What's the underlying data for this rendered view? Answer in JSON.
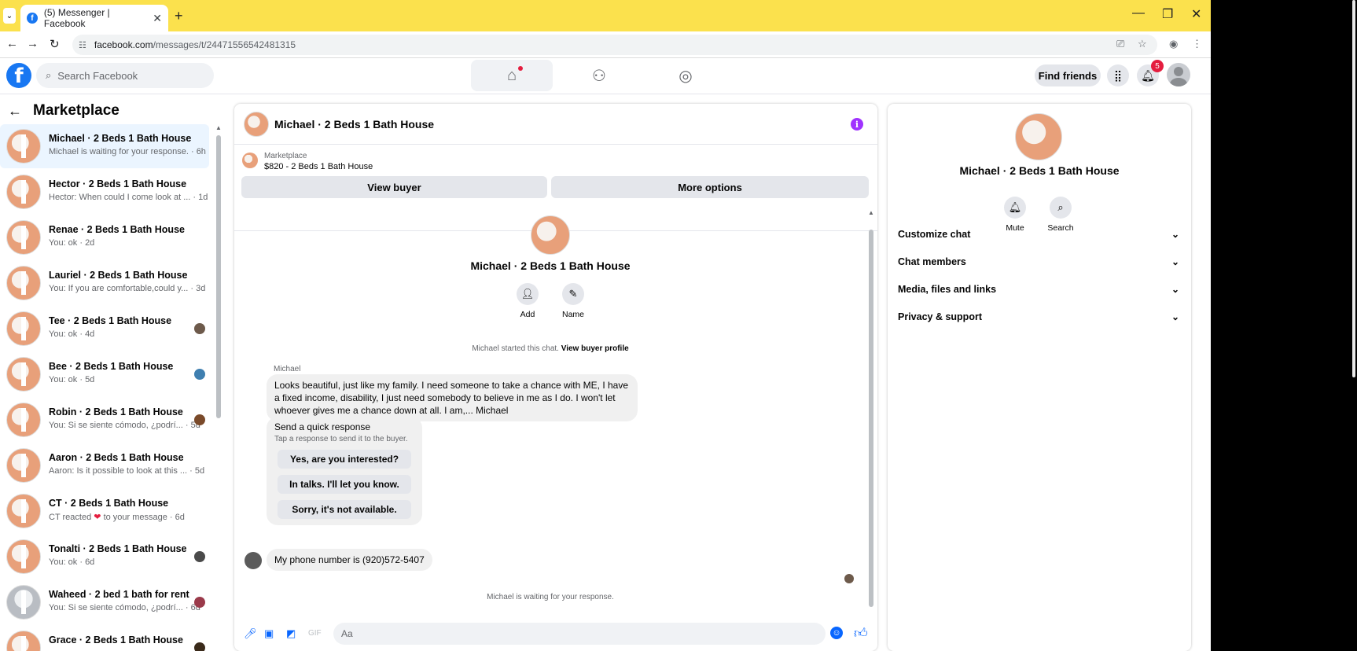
{
  "browser": {
    "tab_title": "(5) Messenger | Facebook",
    "url_host": "facebook.com",
    "url_path": "/messages/t/24471556542481315"
  },
  "header": {
    "search_placeholder": "Search Facebook",
    "find_friends": "Find friends",
    "notification_count": "5"
  },
  "sidebar": {
    "title": "Marketplace",
    "items": [
      {
        "name": "Michael · 2 Beds 1 Bath House",
        "preview": "Michael is waiting for your response. · 6h"
      },
      {
        "name": "Hector · 2 Beds 1 Bath House",
        "preview": "Hector: When could I come look at ... · 1d"
      },
      {
        "name": "Renae · 2 Beds 1 Bath House",
        "preview": "You: ok · 2d"
      },
      {
        "name": "Lauriel · 2 Beds 1 Bath House",
        "preview": "You: If you are comfortable,could y... · 3d"
      },
      {
        "name": "Tee · 2 Beds 1 Bath House",
        "preview": "You: ok · 4d"
      },
      {
        "name": "Bee · 2 Beds 1 Bath House",
        "preview": "You: ok · 5d"
      },
      {
        "name": "Robin · 2 Beds 1 Bath House",
        "preview": "You: Si se siente cómodo, ¿podrí... · 5d"
      },
      {
        "name": "Aaron · 2 Beds 1 Bath House",
        "preview": "Aaron: Is it possible to look at this ... · 5d"
      },
      {
        "name": "CT · 2 Beds 1 Bath House",
        "preview_a": "CT reacted",
        "preview_b": "to your message · 6d"
      },
      {
        "name": "Tonalti · 2 Beds 1 Bath House",
        "preview": "You: ok · 6d"
      },
      {
        "name": "Waheed · 2 bed 1 bath for rent",
        "preview": "You: Si se siente cómodo, ¿podrí... · 6d"
      },
      {
        "name": "Grace · 2 Beds 1 Bath House",
        "preview": ""
      }
    ]
  },
  "chat": {
    "title": "Michael · 2 Beds 1 Bath House",
    "listing_label": "Marketplace",
    "listing_price": "$820 - 2 Beds 1 Bath House",
    "view_buyer": "View buyer",
    "more_options": "More options",
    "add_label": "Add",
    "name_label": "Name",
    "started_text": "Michael started this chat.",
    "view_buyer_profile": "View buyer profile",
    "sender_name": "Michael",
    "message_1": "Looks beautiful,  just like my family.  I need someone to take a chance with ME, I have a fixed income, disability, I just need somebody to believe in me as I do. I won't let whoever gives me a chance down at all. I am,... Michael",
    "quick_title": "Send a quick response",
    "quick_subtitle": "Tap a response to send it to the buyer.",
    "quick_options": [
      "Yes, are you interested?",
      "In talks. I'll let you know.",
      "Sorry, it's not available."
    ],
    "message_2": "My phone number is (920)572-5407",
    "waiting_text": "Michael is waiting for your response.",
    "composer_placeholder": "Aa"
  },
  "info_panel": {
    "title": "Michael · 2 Beds 1 Bath House",
    "mute": "Mute",
    "search": "Search",
    "sections": [
      "Customize chat",
      "Chat members",
      "Media, files and links",
      "Privacy & support"
    ]
  },
  "colors": {
    "accent": "#0866ff",
    "brand": "#1877f2",
    "browser_frame": "#fbe14d",
    "info_icon": "#a033ff"
  }
}
